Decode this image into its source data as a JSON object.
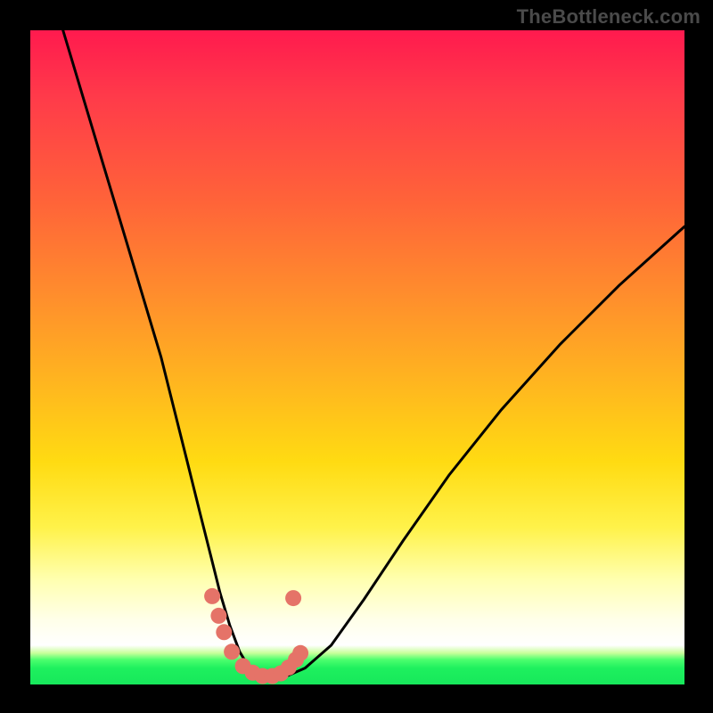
{
  "watermark": "TheBottleneck.com",
  "colors": {
    "frame": "#000000",
    "curve": "#000000",
    "dot": "#e57368",
    "gradient_stops": [
      "#ff1a4e",
      "#ff6339",
      "#ffb61f",
      "#fff24a",
      "#ffffff",
      "#17e85b"
    ]
  },
  "chart_data": {
    "type": "line",
    "title": "",
    "xlabel": "",
    "ylabel": "",
    "xlim": [
      0,
      100
    ],
    "ylim": [
      0,
      100
    ],
    "series": [
      {
        "name": "bottleneck-curve",
        "x": [
          5,
          8,
          11,
          14,
          17,
          20,
          22,
          24,
          26,
          27.5,
          29,
          30.5,
          32,
          33.5,
          35,
          37,
          39,
          42,
          46,
          51,
          57,
          64,
          72,
          81,
          90,
          100
        ],
        "values": [
          100,
          90,
          80,
          70,
          60,
          50,
          42,
          34,
          26,
          20,
          14,
          9,
          5,
          2.5,
          1.3,
          1,
          1.2,
          2.5,
          6,
          13,
          22,
          32,
          42,
          52,
          61,
          70
        ]
      }
    ],
    "markers": [
      {
        "x": 27.8,
        "y": 13.5
      },
      {
        "x": 28.8,
        "y": 10.5
      },
      {
        "x": 29.6,
        "y": 8.0
      },
      {
        "x": 30.8,
        "y": 5.0
      },
      {
        "x": 32.5,
        "y": 2.8
      },
      {
        "x": 34.0,
        "y": 1.8
      },
      {
        "x": 35.5,
        "y": 1.3
      },
      {
        "x": 37.0,
        "y": 1.3
      },
      {
        "x": 38.3,
        "y": 1.7
      },
      {
        "x": 39.5,
        "y": 2.6
      },
      {
        "x": 40.6,
        "y": 3.8
      },
      {
        "x": 41.3,
        "y": 4.8
      },
      {
        "x": 40.2,
        "y": 13.2
      }
    ]
  }
}
